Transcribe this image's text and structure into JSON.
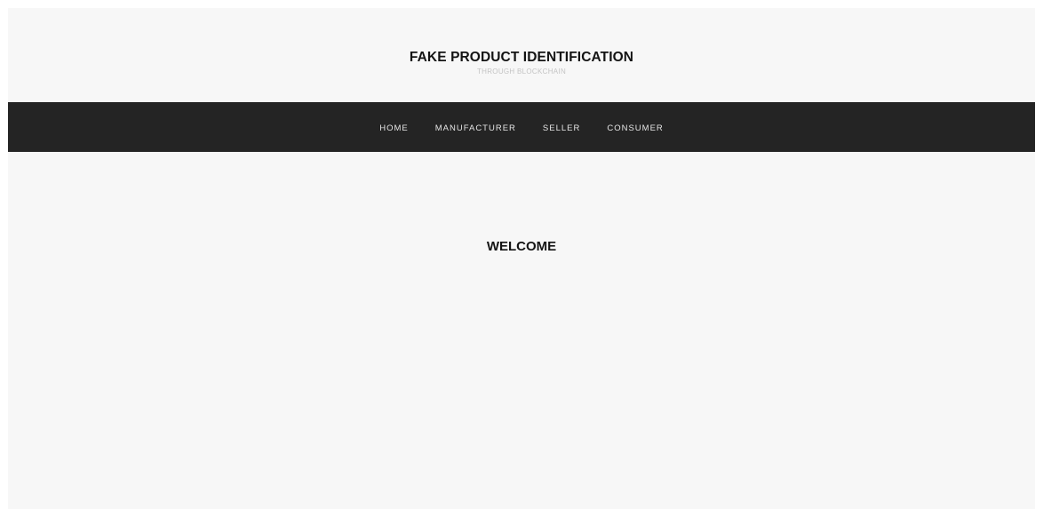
{
  "header": {
    "title": "FAKE PRODUCT IDENTIFICATION",
    "tagline": "THROUGH BLOCKCHAIN"
  },
  "nav": {
    "items": [
      {
        "label": "HOME"
      },
      {
        "label": "MANUFACTURER"
      },
      {
        "label": "SELLER"
      },
      {
        "label": "CONSUMER"
      }
    ]
  },
  "main": {
    "heading": "WELCOME"
  },
  "colors": {
    "page_background": "#f7f7f7",
    "navbar_background": "#242424",
    "nav_text": "#e6e6e6",
    "title_text": "#141414",
    "tagline_text": "#c4c4c4"
  }
}
